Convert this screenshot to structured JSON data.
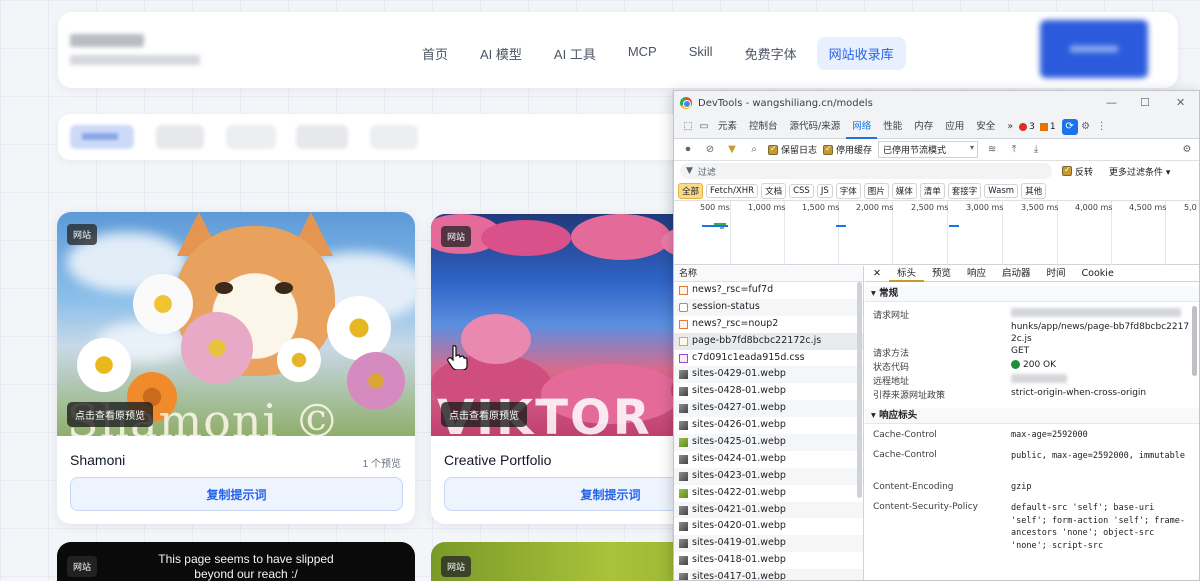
{
  "site": {
    "nav": [
      "首页",
      "AI 模型",
      "AI 工具",
      "MCP",
      "Skill",
      "免费字体",
      "网站收录库"
    ],
    "active_nav_index": 6
  },
  "cards": [
    {
      "badge": "网站",
      "preview_label": "点击查看原预览",
      "title": "Shamoni",
      "count": "1 个预览",
      "copy_label": "复制提示词",
      "image_text": "Shamoni ©"
    },
    {
      "badge": "网站",
      "preview_label": "点击查看原预览",
      "title": "Creative Portfolio",
      "copy_label": "复制提示词",
      "image_text": "VIKTOR"
    }
  ],
  "bottom_cards": [
    {
      "badge": "网站",
      "message": "This page seems to have slipped beyond our reach :/"
    },
    {
      "badge": "网站"
    }
  ],
  "devtools": {
    "title": "DevTools - wangshiliang.cn/models",
    "tabs": [
      "元素",
      "控制台",
      "源代码/来源",
      "网络",
      "性能",
      "内存",
      "应用",
      "安全"
    ],
    "active_tab": "网络",
    "more_tabs": "»",
    "error_count": "3",
    "warning_count": "1",
    "toolbar": {
      "preserve_log": "保留日志",
      "disable_cache": "停用缓存",
      "throttle": "已停用节流模式"
    },
    "filter": {
      "placeholder": "过滤",
      "invert": "反转",
      "more_filters": "更多过滤条件"
    },
    "types": [
      "全部",
      "Fetch/XHR",
      "文档",
      "CSS",
      "JS",
      "字体",
      "图片",
      "媒体",
      "清单",
      "套接字",
      "Wasm",
      "其他"
    ],
    "timeline_ticks": [
      "500 ms",
      "1,000 ms",
      "1,500 ms",
      "2,000 ms",
      "2,500 ms",
      "3,000 ms",
      "3,500 ms",
      "4,000 ms",
      "4,500 ms",
      "5,0"
    ],
    "list_header": "名称",
    "requests": [
      {
        "name": "news?_rsc=fuf7d",
        "kind": "doc"
      },
      {
        "name": "session-status",
        "kind": "json"
      },
      {
        "name": "news?_rsc=noup2",
        "kind": "doc"
      },
      {
        "name": "page-bb7fd8bcbc22172c.js",
        "kind": "js"
      },
      {
        "name": "c7d091c1eada915d.css",
        "kind": "css"
      },
      {
        "name": "sites-0429-01.webp",
        "kind": "img"
      },
      {
        "name": "sites-0428-01.webp",
        "kind": "img"
      },
      {
        "name": "sites-0427-01.webp",
        "kind": "img"
      },
      {
        "name": "sites-0426-01.webp",
        "kind": "img"
      },
      {
        "name": "sites-0425-01.webp",
        "kind": "img-g"
      },
      {
        "name": "sites-0424-01.webp",
        "kind": "img"
      },
      {
        "name": "sites-0423-01.webp",
        "kind": "img"
      },
      {
        "name": "sites-0422-01.webp",
        "kind": "img-g"
      },
      {
        "name": "sites-0421-01.webp",
        "kind": "img"
      },
      {
        "name": "sites-0420-01.webp",
        "kind": "img"
      },
      {
        "name": "sites-0419-01.webp",
        "kind": "img"
      },
      {
        "name": "sites-0418-01.webp",
        "kind": "img"
      },
      {
        "name": "sites-0417-01.webp",
        "kind": "img"
      }
    ],
    "selected_request_index": 3,
    "detail_tabs": [
      "标头",
      "预览",
      "响应",
      "启动器",
      "时间",
      "Cookie"
    ],
    "active_detail_tab": "标头",
    "general": {
      "heading": "常规",
      "request_url_label": "请求网址",
      "request_url_value": "hunks/app/news/page-bb7fd8bcbc22172c.js",
      "method_label": "请求方法",
      "method_value": "GET",
      "status_label": "状态代码",
      "status_value": "200 OK",
      "remote_label": "远程地址",
      "referrer_label": "引荐来源网址政策",
      "referrer_value": "strict-origin-when-cross-origin"
    },
    "response_headers": {
      "heading": "响应标头",
      "rows": [
        {
          "k": "Cache-Control",
          "v": "max-age=2592000"
        },
        {
          "k": "Cache-Control",
          "v": "public, max-age=2592000, immutable"
        },
        {
          "k": "Content-Encoding",
          "v": "gzip"
        },
        {
          "k": "Content-Security-Policy",
          "v": "default-src 'self'; base-uri 'self'; form-action 'self'; frame-ancestors 'none'; object-src 'none'; script-src"
        }
      ]
    }
  }
}
